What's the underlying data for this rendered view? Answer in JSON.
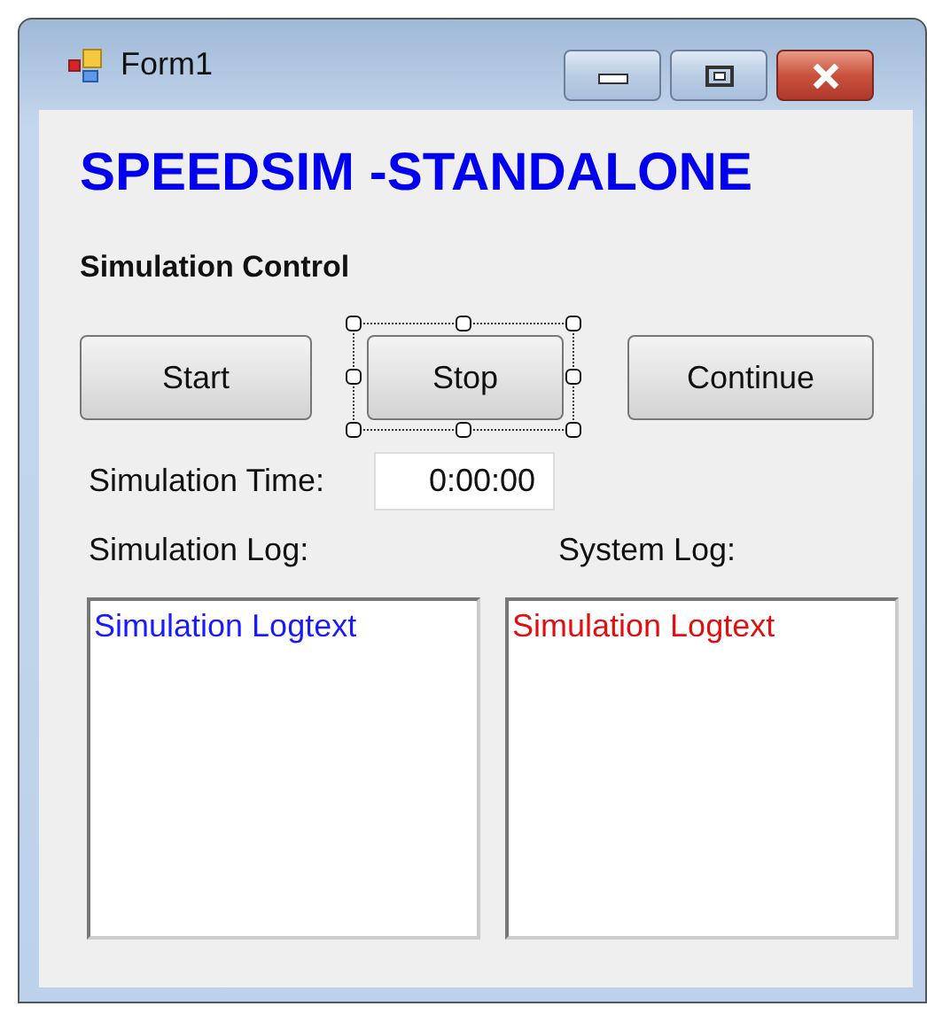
{
  "window": {
    "title": "Form1"
  },
  "heading": "SPEEDSIM -STANDALONE",
  "section_label": "Simulation Control",
  "buttons": [
    {
      "label": "Start",
      "selected": false
    },
    {
      "label": "Stop",
      "selected": true
    },
    {
      "label": "Continue",
      "selected": false
    }
  ],
  "simulation_time": {
    "label": "Simulation Time:",
    "value": "0:00:00"
  },
  "logs": [
    {
      "label": "Simulation Log:",
      "text": "Simulation Logtext",
      "color": "#1a1aff"
    },
    {
      "label": "System Log:",
      "text": "Simulation Logtext",
      "color": "#e01010"
    }
  ]
}
